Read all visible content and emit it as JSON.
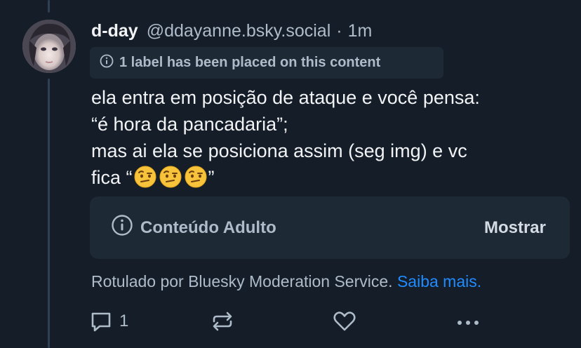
{
  "post": {
    "display_name": "d-day",
    "handle": "@ddayanne.bsky.social",
    "separator": "·",
    "time": "1m",
    "label_notice": "1 label has been placed on this content",
    "text_lines": [
      "ela entra em posição de ataque e você pensa:",
      "“é hora da pancadaria”;",
      "mas ai ela se posiciona assim (seg img) e vc",
      "fica “",
      "”"
    ],
    "emoji": "raised-eyebrow-emoji"
  },
  "content_warning": {
    "label": "Conteúdo Adulto",
    "show_button": "Mostrar"
  },
  "moderation": {
    "note": "Rotulado por Bluesky Moderation Service.",
    "learn_more": "Saiba mais."
  },
  "actions": {
    "reply_count": "1",
    "icons": [
      "reply-icon",
      "repost-icon",
      "like-icon",
      "more-icon"
    ]
  },
  "colors": {
    "background": "#151d28",
    "card": "#1e2936",
    "link": "#208bfe",
    "muted": "#aebbc9"
  }
}
